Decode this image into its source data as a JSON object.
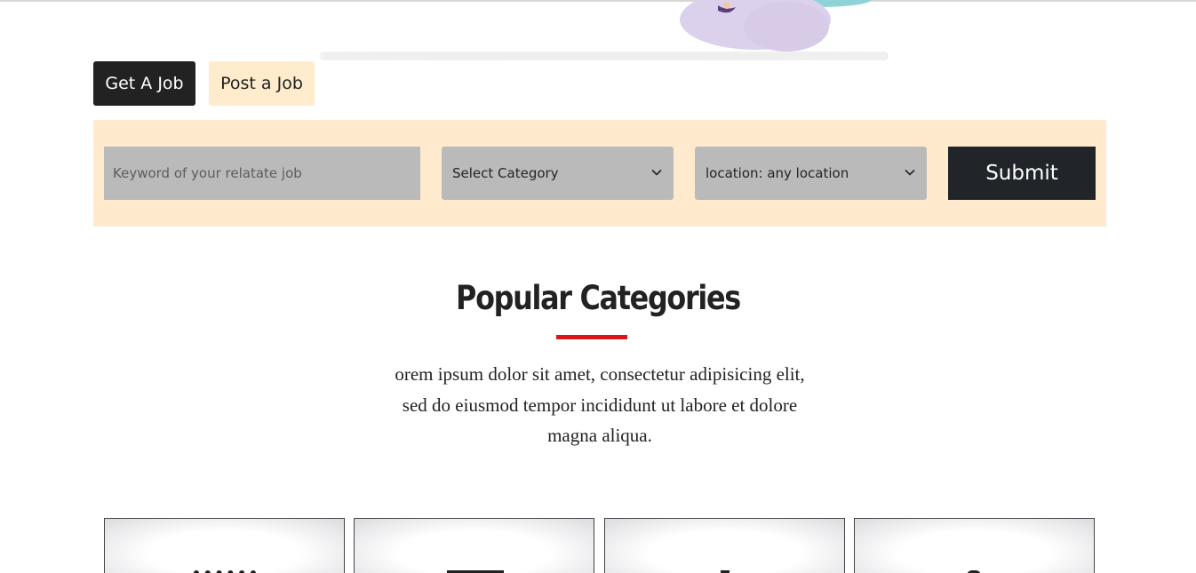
{
  "tabs": {
    "get_job": "Get A Job",
    "post_job": "Post a Job"
  },
  "search": {
    "keyword_placeholder": "Keyword of your relatate job",
    "category_selected": "Select Category",
    "location_selected": "location: any location",
    "submit_label": "Submit"
  },
  "categories_section": {
    "title": "Popular Categories",
    "description": "orem ipsum dolor sit amet, consectetur adipisicing elit, sed do eiusmod tempor incididunt ut labore et dolore magna aliqua."
  },
  "colors": {
    "dark": "#222222",
    "cream": "#ffeacd",
    "accent_red": "#d8161b",
    "field_gray": "#bababa"
  },
  "icons": {
    "select_arrow": "chevron-down-icon"
  }
}
